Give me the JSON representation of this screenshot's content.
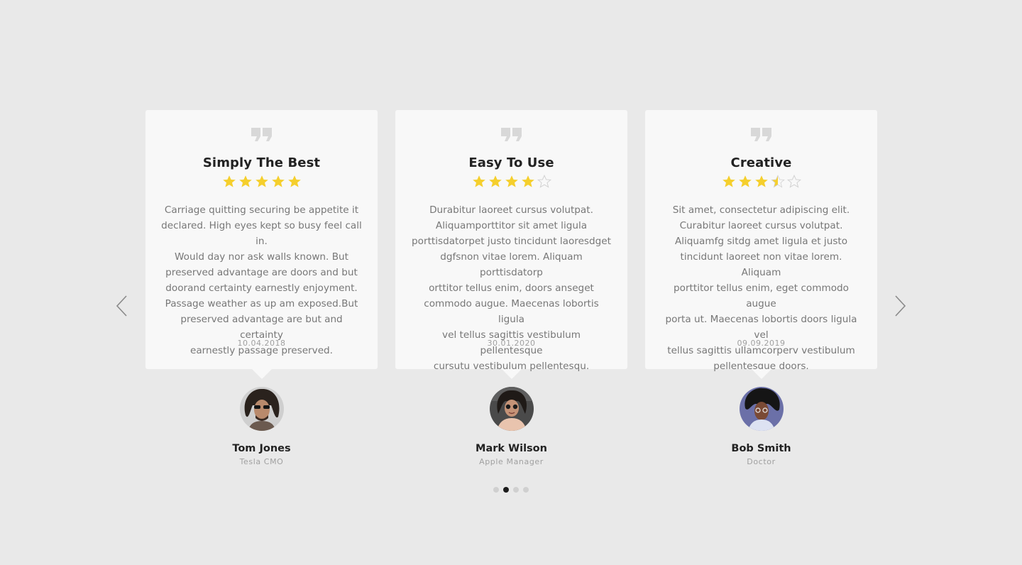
{
  "colors": {
    "background": "#e9e9e9",
    "card": "#f8f8f8",
    "star_filled": "#f5cf2d",
    "star_empty": "#d2d2d2",
    "quote_icon": "#d8d8d8",
    "dot_active": "#1c1c1c",
    "dot_inactive": "#d0d0d0"
  },
  "navigation": {
    "prev_icon": "chevron-left-icon",
    "next_icon": "chevron-right-icon"
  },
  "testimonials": [
    {
      "title": "Simply The Best",
      "rating": 5,
      "rating_max": 5,
      "text": "Carriage quitting securing be appetite it\ndeclared. High eyes kept so busy feel call in.\nWould day nor ask walls known. But\npreserved advantage are doors and but\ndoorand certainty earnestly enjoyment.\nPassage weather as up am exposed.But\npreserved advantage are but and certainty\nearnestly passage preserved.",
      "date": "10.04.2018",
      "name": "Tom Jones",
      "role": "Tesla CMO"
    },
    {
      "title": "Easy To Use",
      "rating": 4,
      "rating_max": 5,
      "text": "Durabitur laoreet cursus volutpat.\nAliquamporttitor sit amet ligula\nporttisdatorpet justo tincidunt laoresdget\ndgfsnon vitae lorem. Aliquam porttisdatorp\norttitor tellus enim, doors anseget\ncommodo augue. Maecenas lobortis ligula\nvel tellus sagittis  vestibulum pellentesque\ncursutu vestibulum pellentesqu.",
      "date": "30.01.2020",
      "name": "Mark Wilson",
      "role": "Apple Manager"
    },
    {
      "title": "Creative",
      "rating": 3.5,
      "rating_max": 5,
      "text": "Sit amet, consectetur adipiscing elit.\nCurabitur laoreet cursus volutpat.\nAliquamfg sitdg amet ligula et justo\ntincidunt laoreet non vitae lorem. Aliquam\nporttitor tellus enim, eget commodo augue\nporta ut. Maecenas lobortis doors ligula vel\ntellus sagittis ullamcorperv vestibulum\npellentesque doors.",
      "date": "09.09.2019",
      "name": "Bob Smith",
      "role": "Doctor"
    }
  ],
  "pagination": {
    "total": 4,
    "active_index": 1
  }
}
